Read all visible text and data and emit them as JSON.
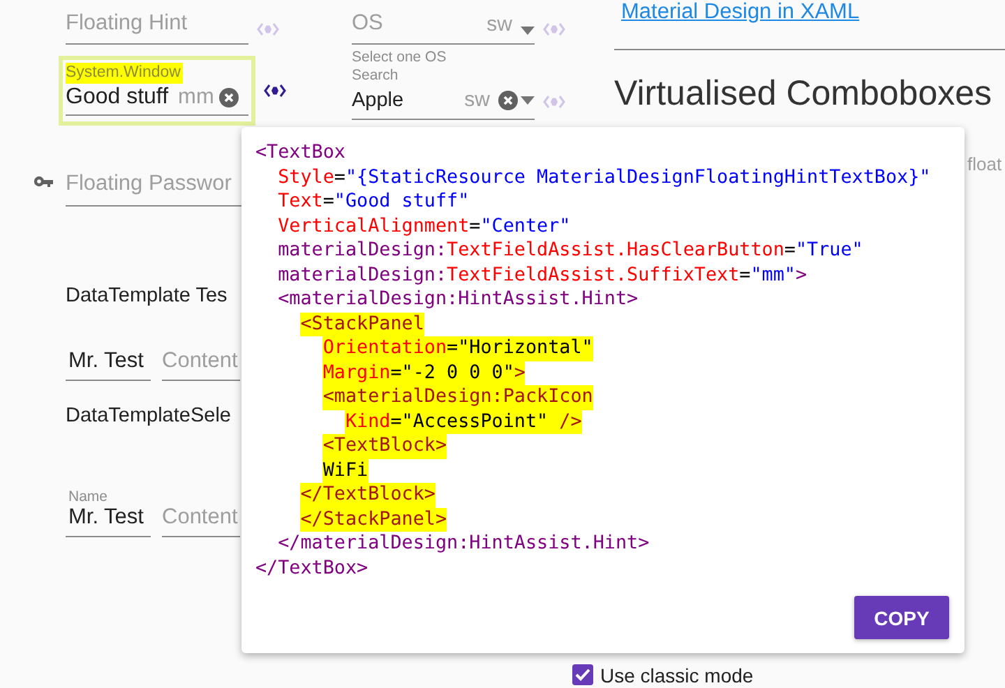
{
  "left_column": {
    "floating_hint": {
      "placeholder": "Floating Hint",
      "code_active": false
    },
    "window_field": {
      "label": "System.Window",
      "value": "Good stuff",
      "suffix": "mm",
      "code_active": true
    },
    "password": {
      "placeholder": "Floating Passwor"
    },
    "template_heading": "DataTemplate Tes",
    "template_row": {
      "name": "Mr. Test",
      "content_placeholder": "Content"
    },
    "selector_heading": "DataTemplateSele",
    "selector_row": {
      "label": "Name",
      "name": "Mr. Test",
      "content_placeholder": "Content"
    }
  },
  "middle_column": {
    "os_combo": {
      "placeholder": "OS",
      "suffix": "sw",
      "helper": "Select one OS",
      "code_active": false
    },
    "fruit_combo": {
      "label": "Search",
      "value": "Apple",
      "suffix": "sw",
      "code_active": false
    }
  },
  "right_column": {
    "link": "Material Design in XAML",
    "heading": "Virtualised Comboboxes",
    "partial_text": "float"
  },
  "code_popup": {
    "lines": [
      {
        "highlighted": false,
        "segments": [
          {
            "kind": "tag",
            "text": "<TextBox"
          }
        ],
        "children": [
          {
            "highlighted": false,
            "segments": [
              {
                "kind": "attr",
                "text": "Style"
              },
              {
                "kind": "plain",
                "text": "="
              },
              {
                "kind": "value",
                "text": "\"{StaticResource MaterialDesignFloatingHintTextBox}\""
              }
            ]
          },
          {
            "highlighted": false,
            "segments": [
              {
                "kind": "attr",
                "text": "Text"
              },
              {
                "kind": "plain",
                "text": "="
              },
              {
                "kind": "value",
                "text": "\"Good stuff\""
              }
            ]
          },
          {
            "highlighted": false,
            "segments": [
              {
                "kind": "attr",
                "text": "VerticalAlignment"
              },
              {
                "kind": "plain",
                "text": "="
              },
              {
                "kind": "value",
                "text": "\"Center\""
              }
            ]
          },
          {
            "highlighted": false,
            "segments": [
              {
                "kind": "tag",
                "text": "materialDesign:"
              },
              {
                "kind": "attr",
                "text": "TextFieldAssist.HasClearButton"
              },
              {
                "kind": "plain",
                "text": "="
              },
              {
                "kind": "value",
                "text": "\"True\""
              }
            ]
          },
          {
            "highlighted": false,
            "segments": [
              {
                "kind": "tag",
                "text": "materialDesign:"
              },
              {
                "kind": "attr",
                "text": "TextFieldAssist.SuffixText"
              },
              {
                "kind": "plain",
                "text": "="
              },
              {
                "kind": "value",
                "text": "\"mm\""
              },
              {
                "kind": "tag",
                "text": ">"
              }
            ]
          },
          {
            "highlighted": false,
            "segments": [
              {
                "kind": "tag",
                "text": "<materialDesign:HintAssist.Hint>"
              }
            ],
            "children": [
              {
                "highlighted": true,
                "segments": [
                  {
                    "kind": "tag",
                    "text": "<StackPanel"
                  }
                ],
                "children": [
                  {
                    "highlighted": true,
                    "segments": [
                      {
                        "kind": "attr",
                        "text": "Orientation"
                      },
                      {
                        "kind": "plain",
                        "text": "=\"Horizontal\""
                      }
                    ]
                  },
                  {
                    "highlighted": true,
                    "segments": [
                      {
                        "kind": "attr",
                        "text": "Margin"
                      },
                      {
                        "kind": "plain",
                        "text": "=\"-2 0 0 0\""
                      },
                      {
                        "kind": "tag",
                        "text": ">"
                      }
                    ]
                  },
                  {
                    "highlighted": true,
                    "segments": [
                      {
                        "kind": "tag",
                        "text": "<materialDesign:PackIcon"
                      }
                    ],
                    "children": [
                      {
                        "highlighted": true,
                        "segments": [
                          {
                            "kind": "attr",
                            "text": "Kind"
                          },
                          {
                            "kind": "plain",
                            "text": "=\"AccessPoint\" "
                          },
                          {
                            "kind": "tag",
                            "text": "/>"
                          }
                        ]
                      }
                    ]
                  },
                  {
                    "highlighted": true,
                    "segments": [
                      {
                        "kind": "tag",
                        "text": "<TextBlock>"
                      }
                    ]
                  },
                  {
                    "highlighted": true,
                    "segments": [
                      {
                        "kind": "plain",
                        "text": "WiFi"
                      }
                    ]
                  }
                ]
              },
              {
                "highlighted": true,
                "segments": [
                  {
                    "kind": "tag",
                    "text": "</TextBlock>"
                  }
                ]
              },
              {
                "highlighted": true,
                "segments": [
                  {
                    "kind": "tag",
                    "text": "</StackPanel>"
                  }
                ]
              }
            ]
          },
          {
            "highlighted": false,
            "segments": [
              {
                "kind": "tag",
                "text": "</materialDesign:HintAssist.Hint>"
              }
            ]
          }
        ]
      },
      {
        "highlighted": false,
        "segments": [
          {
            "kind": "tag",
            "text": "</TextBox>"
          }
        ]
      }
    ],
    "button": "COPY"
  },
  "classic_mode": {
    "label": "Use classic mode",
    "checked": true
  }
}
